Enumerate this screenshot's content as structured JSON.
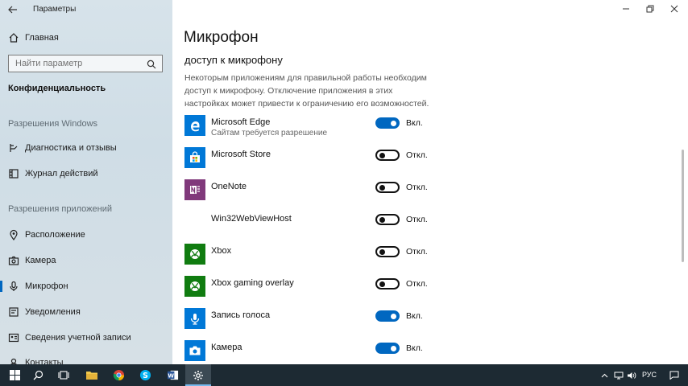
{
  "window": {
    "title": "Параметры"
  },
  "sidebar": {
    "home_label": "Главная",
    "search_placeholder": "Найти параметр",
    "privacy_header": "Конфиденциальность",
    "windows_permissions_header": "Разрешения Windows",
    "windows_items": [
      {
        "label": "Диагностика и отзывы",
        "icon": "diagnostics-icon"
      },
      {
        "label": "Журнал действий",
        "icon": "activity-history-icon"
      }
    ],
    "app_permissions_header": "Разрешения приложений",
    "app_items": [
      {
        "label": "Расположение",
        "icon": "location-icon"
      },
      {
        "label": "Камера",
        "icon": "camera-icon"
      },
      {
        "label": "Микрофон",
        "icon": "microphone-icon",
        "active": true
      },
      {
        "label": "Уведомления",
        "icon": "notifications-icon"
      },
      {
        "label": "Сведения учетной записи",
        "icon": "account-info-icon"
      },
      {
        "label": "Контакты",
        "icon": "contacts-icon"
      }
    ]
  },
  "main": {
    "title": "Микрофон",
    "subtitle": "доступ к микрофону",
    "description": "Некоторым приложениям для правильной работы необходим доступ к микрофону. Отключение приложения в этих настройках может привести к ограничению его возможностей.",
    "apps": [
      {
        "name": "Microsoft Edge",
        "sub": "Сайтам требуется разрешение",
        "on": true,
        "state": "Вкл.",
        "icon": "edge-icon",
        "color": "#0078d7"
      },
      {
        "name": "Microsoft Store",
        "sub": "",
        "on": false,
        "state": "Откл.",
        "icon": "store-icon",
        "color": "#0078d7"
      },
      {
        "name": "OneNote",
        "sub": "",
        "on": false,
        "state": "Откл.",
        "icon": "onenote-icon",
        "color": "#80397b"
      },
      {
        "name": "Win32WebViewHost",
        "sub": "",
        "on": false,
        "state": "Откл.",
        "icon": "",
        "color": ""
      },
      {
        "name": "Xbox",
        "sub": "",
        "on": false,
        "state": "Откл.",
        "icon": "xbox-icon",
        "color": "#107c10"
      },
      {
        "name": "Xbox gaming overlay",
        "sub": "",
        "on": false,
        "state": "Откл.",
        "icon": "xbox-overlay-icon",
        "color": "#107c10"
      },
      {
        "name": "Запись голоса",
        "sub": "",
        "on": true,
        "state": "Вкл.",
        "icon": "voice-recorder-icon",
        "color": "#0078d7"
      },
      {
        "name": "Камера",
        "sub": "",
        "on": true,
        "state": "Вкл.",
        "icon": "camera-app-icon",
        "color": "#0078d7"
      }
    ]
  },
  "taskbar": {
    "language": "РУС",
    "items": [
      "start-icon",
      "search-icon",
      "task-view-icon",
      "file-explorer-icon",
      "chrome-icon",
      "skype-icon",
      "word-icon",
      "settings-icon"
    ]
  },
  "colors": {
    "accent": "#0067c0",
    "taskbar": "#1d2a33"
  }
}
